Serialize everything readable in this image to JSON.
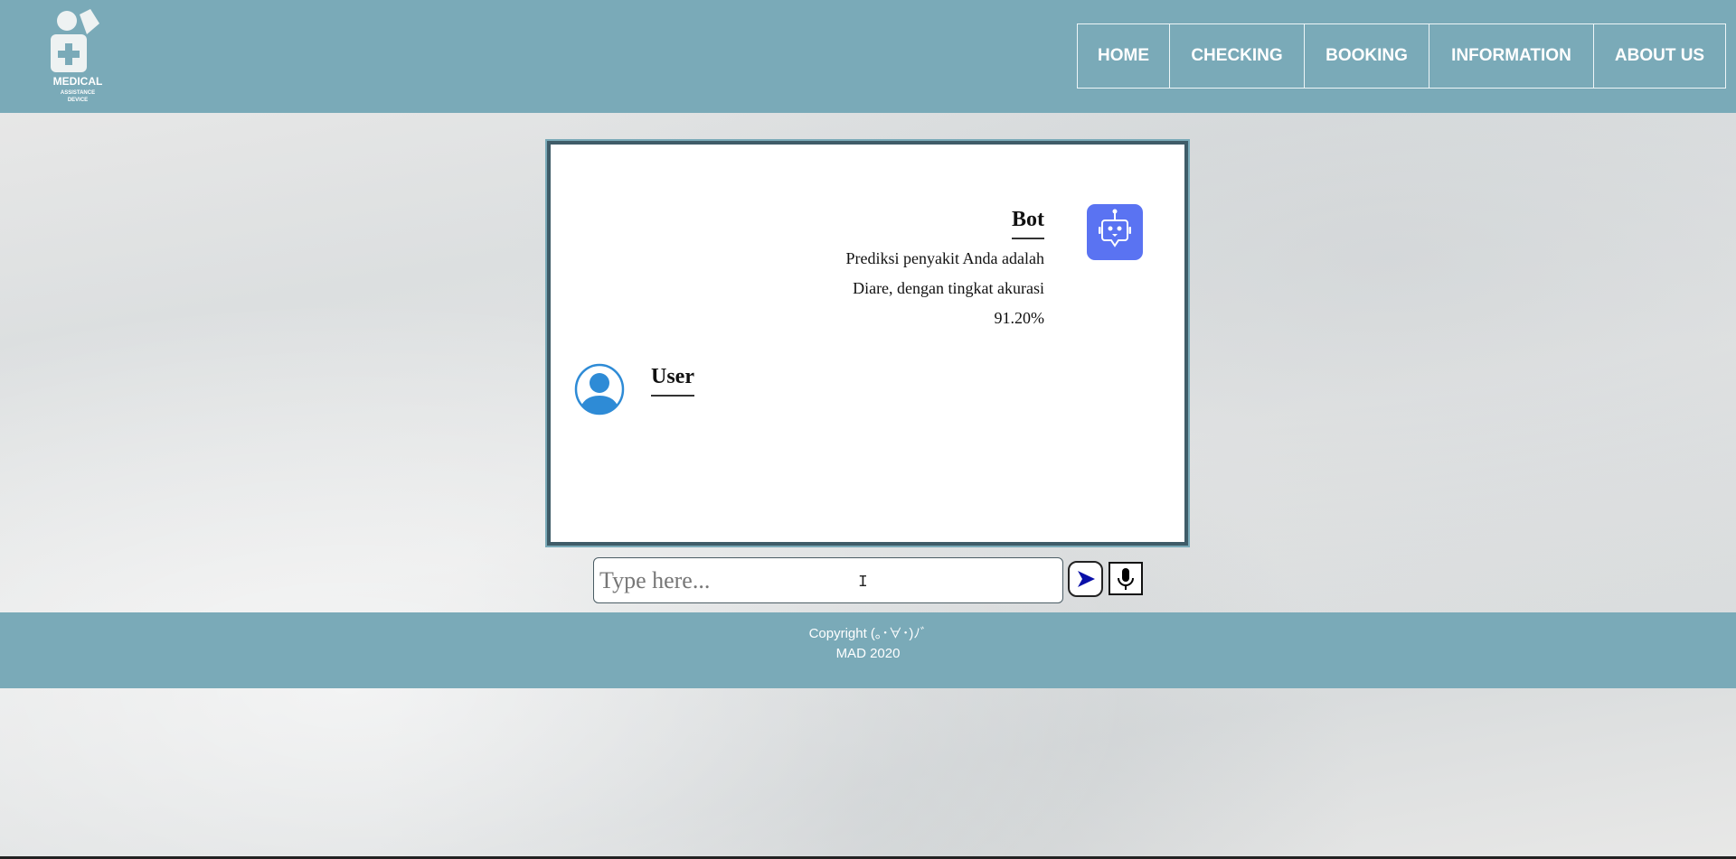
{
  "header": {
    "logo_text": "MEDICAL ASSISTANCE DEVICE",
    "nav": [
      {
        "label": "HOME"
      },
      {
        "label": "CHECKING"
      },
      {
        "label": "BOOKING"
      },
      {
        "label": "INFORMATION"
      },
      {
        "label": "ABOUT US"
      }
    ]
  },
  "chat": {
    "bot": {
      "name": "Bot",
      "icon": "robot-icon",
      "message_lines": [
        "Prediksi penyakit Anda adalah",
        "Diare, dengan tingkat akurasi",
        "91.20%"
      ]
    },
    "user": {
      "name": "User",
      "icon": "user-avatar-icon"
    }
  },
  "input": {
    "value": "",
    "placeholder": "Type here..."
  },
  "footer": {
    "line1": "Copyright (｡･∀･)ﾉﾞ",
    "line2": "MAD 2020"
  },
  "colors": {
    "brand": "#7aaab8",
    "bot_avatar": "#5a73f2",
    "user_avatar": "#2e8bd6"
  }
}
